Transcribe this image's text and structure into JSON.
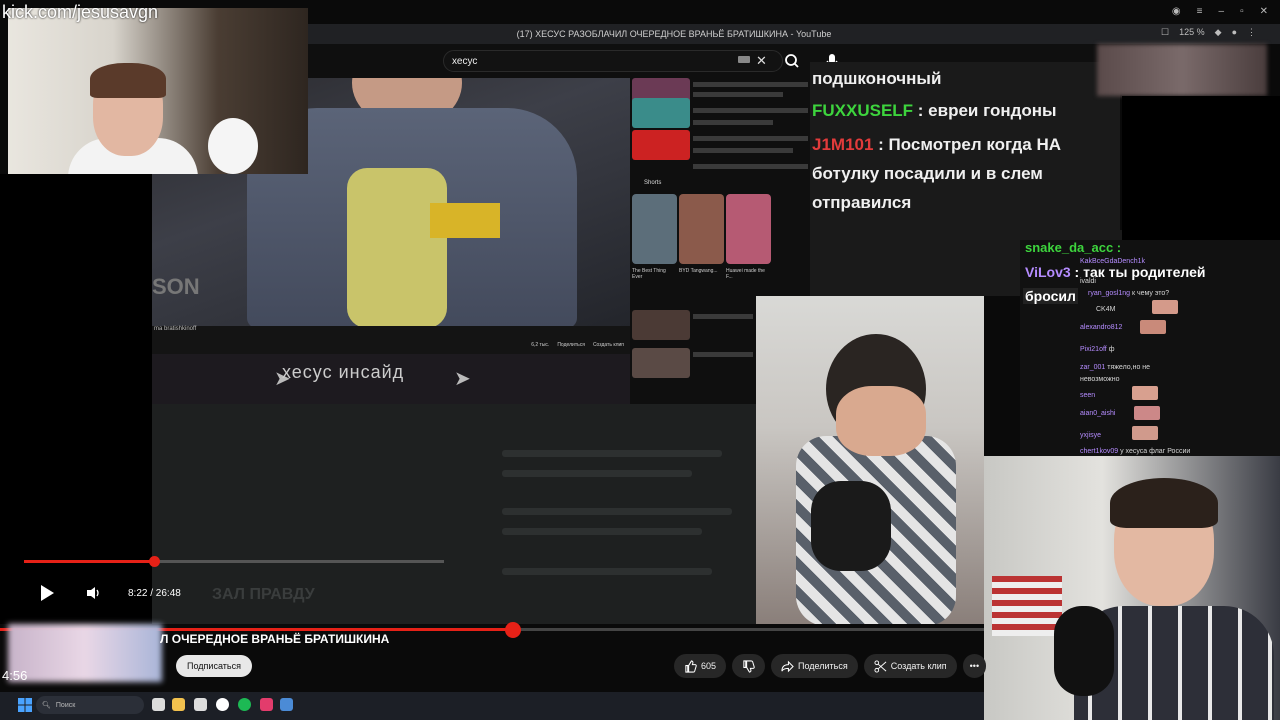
{
  "watermark": "kick.com/jesusavgn",
  "browser": {
    "tab_title": "(17) ХЕСУС РАЗОБЛАЧИЛ ОЧЕРЕДНОЕ ВРАНЬЁ БРАТИШКИНА - YouTube",
    "zoom": "125 %"
  },
  "youtube": {
    "search_value": "хесус",
    "video_channel": "ma bratishkinoff",
    "telegram_banner": "хесус инсайд",
    "player_time": "8:22 / 26:48",
    "player_progress": 0.31,
    "shorts_label": "Shorts",
    "short_captions": [
      "The Best Thing Ever",
      "BYD Tangwang...",
      "Huawei made the F..."
    ],
    "ghost_title": "ЗАЛ ПРАВДУ",
    "bottom_title": "Л ОЧЕРЕДНОЕ ВРАНЬЁ БРАТИШКИНА",
    "subscribe_label": "Подписаться",
    "like_count": "605",
    "share_label": "Поделиться",
    "clip_label": "Создать клип",
    "bottom_progress": 0.52,
    "mini_actions": [
      "6,2 тыс.",
      "Поделиться",
      "Создать клип"
    ]
  },
  "corner_time": "4:56",
  "chat_top": [
    {
      "user": "",
      "text": "подшконочный",
      "color": "#f0f0f0"
    },
    {
      "user": "FUXXUSELF",
      "text": ": евреи гондоны",
      "color": "#3dd43d"
    },
    {
      "user": "J1M101",
      "text": ": Посмотрел когда НА",
      "color": "#e23b3b"
    },
    {
      "user": "",
      "text": "ботулку посадили и в слем",
      "color": "#f0f0f0"
    },
    {
      "user": "",
      "text": "отправился",
      "color": "#f0f0f0"
    }
  ],
  "kick_chat": {
    "top_user": "snake_da_acc :",
    "big_user": "ViLov3",
    "big_text": ": так ты родителей",
    "big_text_2": "бросил",
    "lines": [
      {
        "user": "KakBceGdaDench1k",
        "text": ""
      },
      {
        "user": "",
        "text": "ivaldi"
      },
      {
        "user": "ryan_gosl1ng",
        "text": "к чему это?"
      },
      {
        "user": "",
        "text": "CK4M"
      },
      {
        "user": "alexandro812",
        "text": ""
      },
      {
        "user": "Pixi21off",
        "text": "ф"
      },
      {
        "user": "zar_001",
        "text": "тяжело,но не"
      },
      {
        "user": "",
        "text": "невозможно"
      },
      {
        "user": "",
        "text": "seen"
      },
      {
        "user": "aian0_aishi",
        "text": ""
      },
      {
        "user": "yxjisye",
        "text": ""
      },
      {
        "user": "chert1kov09",
        "text": "у хесуса флаг России"
      }
    ]
  },
  "taskbar": {
    "search_placeholder": "Поиск"
  }
}
